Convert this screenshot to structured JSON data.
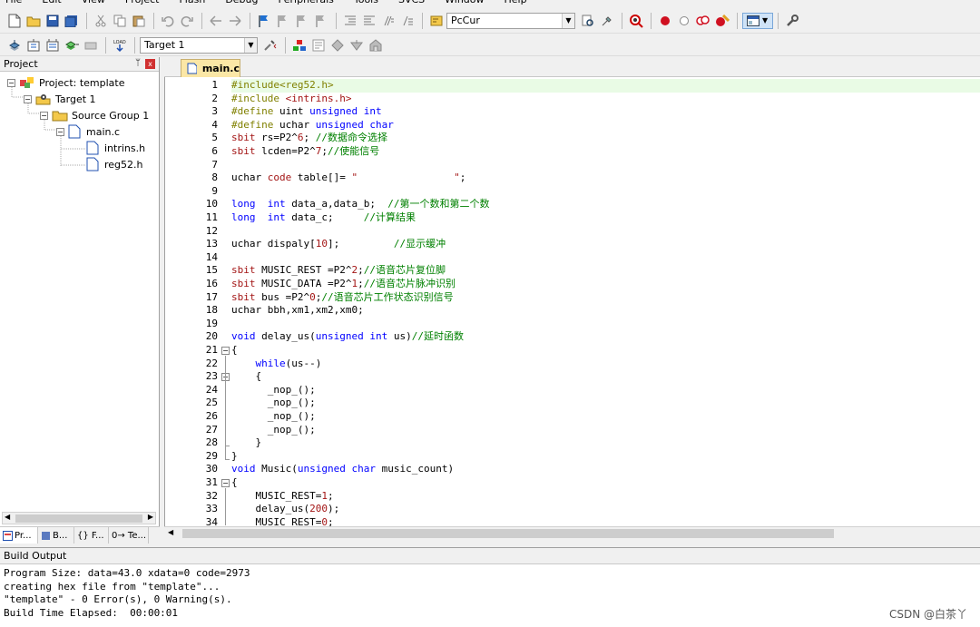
{
  "menubar": [
    "File",
    "Edit",
    "View",
    "Project",
    "Flash",
    "Debug",
    "Peripherals",
    "Tools",
    "SVCS",
    "Window",
    "Help"
  ],
  "toolbar1": {
    "target_dropdown": "PcCur"
  },
  "toolbar2": {
    "target_select": "Target 1"
  },
  "project": {
    "title": "Project",
    "pin": "ᛘ",
    "close": "x",
    "tree": [
      {
        "label": "Project: template",
        "level": 0,
        "icon": "project-icon",
        "expanded": true
      },
      {
        "label": "Target 1",
        "level": 1,
        "icon": "target-icon",
        "expanded": true
      },
      {
        "label": "Source Group 1",
        "level": 2,
        "icon": "folder-icon",
        "expanded": true
      },
      {
        "label": "main.c",
        "level": 3,
        "icon": "file-icon",
        "expanded": true
      },
      {
        "label": "intrins.h",
        "level": 4,
        "icon": "file-icon",
        "expanded": null
      },
      {
        "label": "reg52.h",
        "level": 4,
        "icon": "file-icon",
        "expanded": null
      }
    ],
    "tabs": [
      "Pr...",
      "B...",
      "{} F...",
      "0→ Te..."
    ]
  },
  "editor": {
    "tab": "main.c",
    "start_line": 1,
    "lines": [
      [
        [
          "pp",
          "#include<reg52.h>"
        ]
      ],
      [
        [
          "pp",
          "#include "
        ],
        [
          "st",
          "<intrins.h>"
        ]
      ],
      [
        [
          "pp",
          "#define "
        ],
        [
          "nm",
          "uint "
        ],
        [
          "kw",
          "unsigned int"
        ]
      ],
      [
        [
          "pp",
          "#define "
        ],
        [
          "nm",
          "uchar "
        ],
        [
          "kw",
          "unsigned char"
        ]
      ],
      [
        [
          "st",
          "sbit "
        ],
        [
          "nm",
          "rs=P2^"
        ],
        [
          "st",
          "6"
        ],
        [
          "nm",
          "; "
        ],
        [
          "cm",
          "//数据命令选择"
        ]
      ],
      [
        [
          "st",
          "sbit "
        ],
        [
          "nm",
          "lcden=P2^"
        ],
        [
          "st",
          "7"
        ],
        [
          "nm",
          ";"
        ],
        [
          "cm",
          "//使能信号"
        ]
      ],
      [],
      [
        [
          "nm",
          "uchar "
        ],
        [
          "st",
          "code "
        ],
        [
          "nm",
          "table[]= "
        ],
        [
          "st",
          "\"                \""
        ],
        [
          "nm",
          ";"
        ]
      ],
      [],
      [
        [
          "kw",
          "long  int "
        ],
        [
          "nm",
          "data_a,data_b;  "
        ],
        [
          "cm",
          "//第一个数和第二个数"
        ]
      ],
      [
        [
          "kw",
          "long  int "
        ],
        [
          "nm",
          "data_c;     "
        ],
        [
          "cm",
          "//计算结果"
        ]
      ],
      [],
      [
        [
          "nm",
          "uchar dispaly["
        ],
        [
          "st",
          "10"
        ],
        [
          "nm",
          "];         "
        ],
        [
          "cm",
          "//显示缓冲"
        ]
      ],
      [],
      [
        [
          "st",
          "sbit "
        ],
        [
          "nm",
          "MUSIC_REST =P2^"
        ],
        [
          "st",
          "2"
        ],
        [
          "nm",
          ";"
        ],
        [
          "cm",
          "//语音芯片复位脚"
        ]
      ],
      [
        [
          "st",
          "sbit "
        ],
        [
          "nm",
          "MUSIC_DATA =P2^"
        ],
        [
          "st",
          "1"
        ],
        [
          "nm",
          ";"
        ],
        [
          "cm",
          "//语音芯片脉冲识别"
        ]
      ],
      [
        [
          "st",
          "sbit "
        ],
        [
          "nm",
          "bus =P2^"
        ],
        [
          "st",
          "0"
        ],
        [
          "nm",
          ";"
        ],
        [
          "cm",
          "//语音芯片工作状态识别信号"
        ]
      ],
      [
        [
          "nm",
          "uchar bbh,xm1,xm2,xm0;"
        ]
      ],
      [],
      [
        [
          "kw",
          "void "
        ],
        [
          "nm",
          "delay_us("
        ],
        [
          "kw",
          "unsigned int "
        ],
        [
          "nm",
          "us)"
        ],
        [
          "cm",
          "//延时函数"
        ]
      ],
      [
        [
          "nm",
          "{"
        ]
      ],
      [
        [
          "nm",
          "    "
        ],
        [
          "kw",
          "while"
        ],
        [
          "nm",
          "(us--)"
        ]
      ],
      [
        [
          "nm",
          "    {"
        ]
      ],
      [
        [
          "nm",
          "      _nop_();"
        ]
      ],
      [
        [
          "nm",
          "      _nop_();"
        ]
      ],
      [
        [
          "nm",
          "      _nop_();"
        ]
      ],
      [
        [
          "nm",
          "      _nop_();"
        ]
      ],
      [
        [
          "nm",
          "    }"
        ]
      ],
      [
        [
          "nm",
          "}"
        ]
      ],
      [
        [
          "kw",
          "void "
        ],
        [
          "nm",
          "Music("
        ],
        [
          "kw",
          "unsigned char "
        ],
        [
          "nm",
          "music_count)"
        ]
      ],
      [
        [
          "nm",
          "{"
        ]
      ],
      [
        [
          "nm",
          "    MUSIC_REST="
        ],
        [
          "st",
          "1"
        ],
        [
          "nm",
          ";"
        ]
      ],
      [
        [
          "nm",
          "    delay_us("
        ],
        [
          "st",
          "200"
        ],
        [
          "nm",
          ");"
        ]
      ],
      [
        [
          "nm",
          "    MUSIC_REST="
        ],
        [
          "st",
          "0"
        ],
        [
          "nm",
          ";"
        ]
      ]
    ],
    "folds": [
      {
        "line": 21,
        "type": "start"
      },
      {
        "line": 23,
        "type": "start"
      },
      {
        "line": 28,
        "type": "end"
      },
      {
        "line": 29,
        "type": "end"
      },
      {
        "line": 31,
        "type": "start"
      }
    ]
  },
  "build": {
    "title": "Build Output",
    "lines": [
      "Program Size: data=43.0 xdata=0 code=2973",
      "creating hex file from \"template\"...",
      "\"template\" - 0 Error(s), 0 Warning(s).",
      "Build Time Elapsed:  00:00:01"
    ]
  },
  "watermark": "CSDN @白茶丫",
  "colors": {
    "keyword": "#0000ff",
    "preprocessor": "#808000",
    "comment": "#008000",
    "literal": "#a31515",
    "active_line": "#e9fbe5",
    "tab_active": "#fbe7a6"
  }
}
